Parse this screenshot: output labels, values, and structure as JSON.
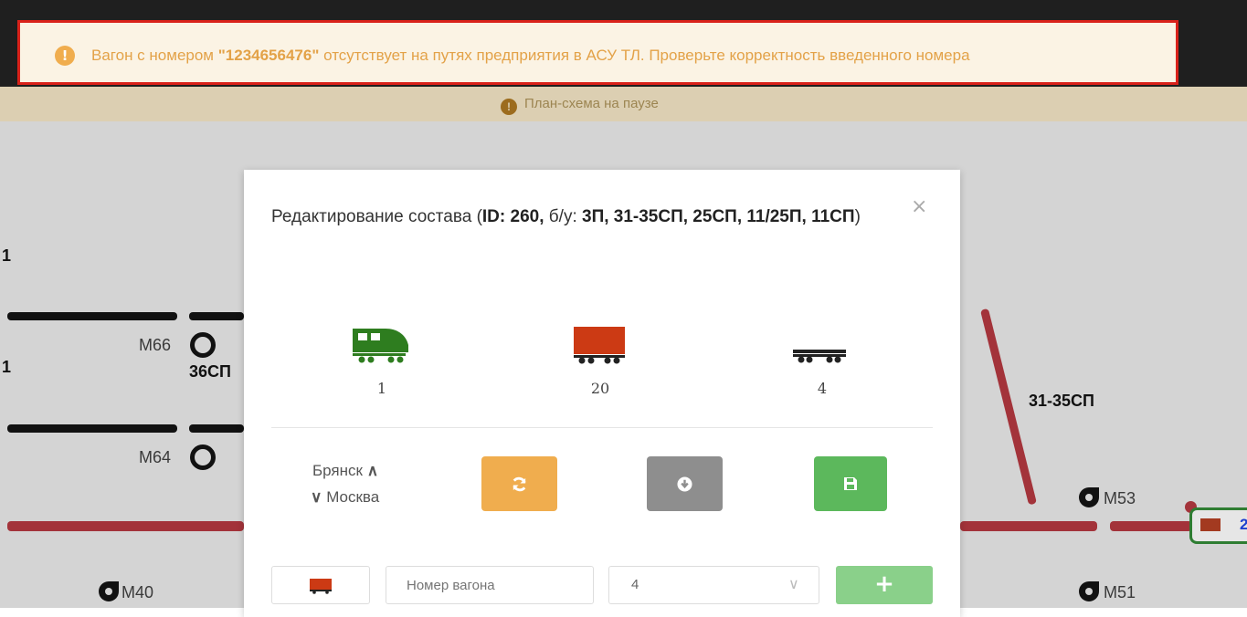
{
  "alert": {
    "prefix": "Вагон с номером ",
    "number": "\"1234656476\"",
    "suffix": " отсутствует на путях предприятия в АСУ ТЛ. Проверьте корректность введенного номера",
    "icon": "exclamation-circle-icon"
  },
  "scheme": {
    "pause_text": "План-схема на паузе",
    "labels": {
      "m66": "M66",
      "m64": "M64",
      "m53": "M53",
      "m51": "M51",
      "m40": "M40",
      "sp36": "36СП",
      "sp3135": "31-35СП"
    }
  },
  "modal": {
    "title_prefix": "Редактирование состава (",
    "title_id": "ID: 260,",
    "title_bu_label": " б/у: ",
    "title_bu_value": "3П, 31-35СП, 25СП, 11/25П, 11СП",
    "title_suffix": ")",
    "close": "×",
    "counts": {
      "locomotive": "1",
      "wagon": "20",
      "platform": "4"
    },
    "direction_from": "Брянск",
    "direction_to": "Москва",
    "wagon_input_placeholder": "Номер вагона",
    "select_value": "4",
    "add_label": "+"
  },
  "colors": {
    "alert_border": "#d9221a",
    "alert_text": "#e3a248",
    "loco_green": "#2e7d1f",
    "wagon_red": "#cc3a14",
    "btn_orange": "#f0ad4e",
    "btn_gray": "#8e8e8e",
    "btn_green": "#5cb85c"
  }
}
